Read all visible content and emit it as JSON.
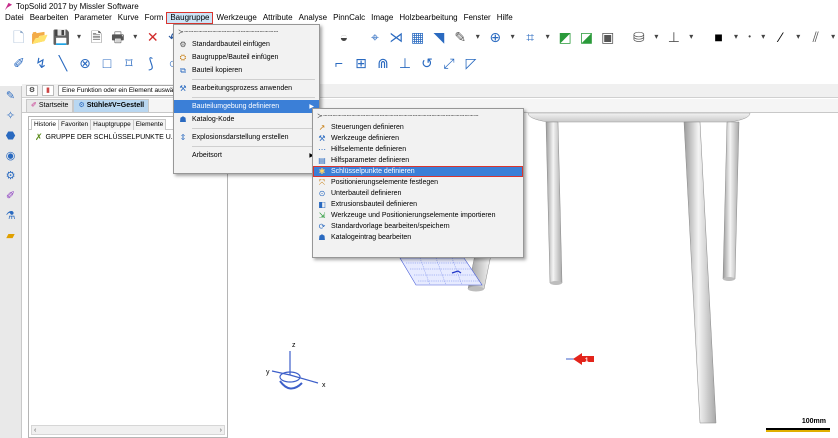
{
  "window": {
    "title": "TopSolid 2017 by Missler Software"
  },
  "menubar": {
    "items": [
      "Datei",
      "Bearbeiten",
      "Parameter",
      "Kurve",
      "Form",
      "Baugruppe",
      "Werkzeuge",
      "Attribute",
      "Analyse",
      "PinnCalc",
      "Image",
      "Holzbearbeitung",
      "Fenster",
      "Hilfe"
    ],
    "active": "Baugruppe"
  },
  "infobar": {
    "message": "Eine Funktion oder ein Element auswählen"
  },
  "doc_tabs": {
    "start": "Startseite",
    "document": "Stühle#V=Gestell"
  },
  "left_panel": {
    "tabs": [
      "Historie",
      "Favoriten",
      "Hauptgruppe",
      "Elemente"
    ],
    "tree_item": "GRUPPE DER SCHLÜSSELPUNKTE U."
  },
  "baugruppe_menu": {
    "tearoff": "≻┄┄┄┄┄┄┄┄┄┄┄┄┄┄┄┄┄┄┄┄",
    "items": [
      {
        "label": "Standardbauteil einfügen",
        "icon": "gear-icon"
      },
      {
        "label": "Baugruppe/Bauteil einfügen",
        "icon": "assembly-icon"
      },
      {
        "label": "Bauteil kopieren",
        "icon": "copy-icon"
      },
      {
        "label": "Bearbeitungsprozess anwenden",
        "icon": "process-icon"
      },
      {
        "label": "Bauteilumgebung definieren",
        "icon": ""
      },
      {
        "label": "Katalog-Kode",
        "icon": "catalog-icon"
      },
      {
        "label": "Explosionsdarstellung erstellen",
        "icon": "explode-icon"
      },
      {
        "label": "Arbeitsort",
        "icon": ""
      }
    ]
  },
  "submenu": {
    "tearoff": "≻┄┄┄┄┄┄┄┄┄┄┄┄┄┄┄┄┄┄┄┄┄┄┄┄┄┄┄┄┄┄┄┄┄",
    "items": [
      {
        "label": "Steuerungen definieren",
        "icon": "control-icon"
      },
      {
        "label": "Werkzeuge definieren",
        "icon": "tools-icon"
      },
      {
        "label": "Hilfselemente definieren",
        "icon": "helper-icon"
      },
      {
        "label": "Hilfsparameter definieren",
        "icon": "parameter-icon"
      },
      {
        "label": "Schlüsselpunkte definieren",
        "icon": "keypoint-icon"
      },
      {
        "label": "Positionierungselemente festlegen",
        "icon": "position-icon"
      },
      {
        "label": "Unterbauteil definieren",
        "icon": "subpart-icon"
      },
      {
        "label": "Extrusionsbauteil definieren",
        "icon": "extrusion-icon"
      },
      {
        "label": "Werkzeuge und Positionierungselemente importieren",
        "icon": "import-icon"
      },
      {
        "label": "Standardvorlage bearbeiten/speichern",
        "icon": "template-icon"
      },
      {
        "label": "Katalogeintrag bearbeiten",
        "icon": "catalog-entry-icon"
      }
    ]
  },
  "viewport": {
    "axes": {
      "x": "x",
      "y": "y",
      "z": "z"
    },
    "marker_number": "1",
    "scale_label": "100mm"
  },
  "colors": {
    "highlight": "#3b7fd7",
    "annotation_red": "#d9352f",
    "selection_blue": "#cce4f7"
  }
}
